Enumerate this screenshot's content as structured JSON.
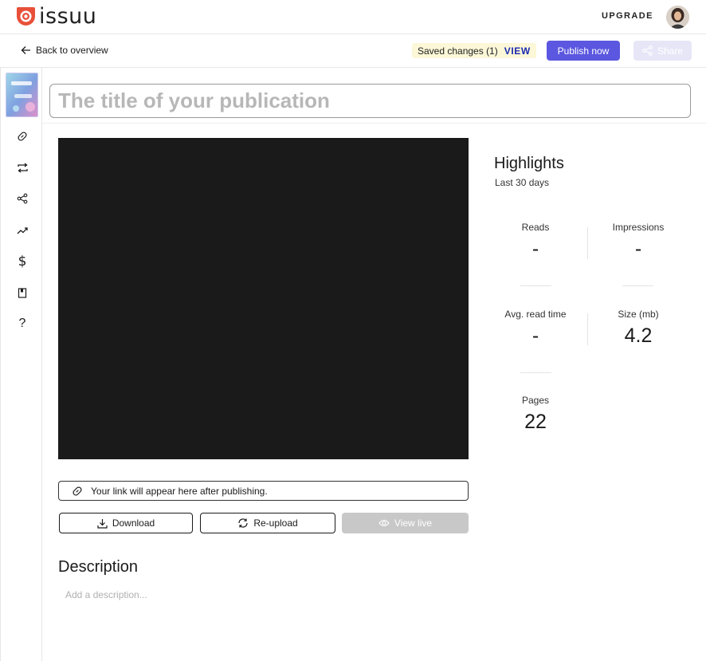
{
  "header": {
    "logo_text": "issuu",
    "upgrade_label": "UPGRADE"
  },
  "toolbar": {
    "back_label": "Back to overview",
    "saved_label": "Saved changes (1)",
    "view_label": "VIEW",
    "publish_label": "Publish now",
    "share_label": "Share"
  },
  "sidebar": {
    "icons": [
      "link-icon",
      "loop-icon",
      "share-icon",
      "trend-icon",
      "dollar-icon",
      "book-icon",
      "help-icon"
    ]
  },
  "publication": {
    "title_placeholder": "The title of your publication",
    "link_text": "Your link will appear here after publishing.",
    "download_label": "Download",
    "reupload_label": "Re-upload",
    "viewlive_label": "View live",
    "description_heading": "Description",
    "description_placeholder": "Add a description..."
  },
  "highlights": {
    "title": "Highlights",
    "period": "Last 30 days",
    "reads_label": "Reads",
    "reads_value": "-",
    "impressions_label": "Impressions",
    "impressions_value": "-",
    "avg_read_label": "Avg. read time",
    "avg_read_value": "-",
    "size_label": "Size (mb)",
    "size_value": "4.2",
    "pages_label": "Pages",
    "pages_value": "22"
  },
  "colors": {
    "brand": "#e8503a",
    "accent": "#5b57e0",
    "saved_bg": "#fbf7d7",
    "view_link": "#1d2ab0"
  }
}
